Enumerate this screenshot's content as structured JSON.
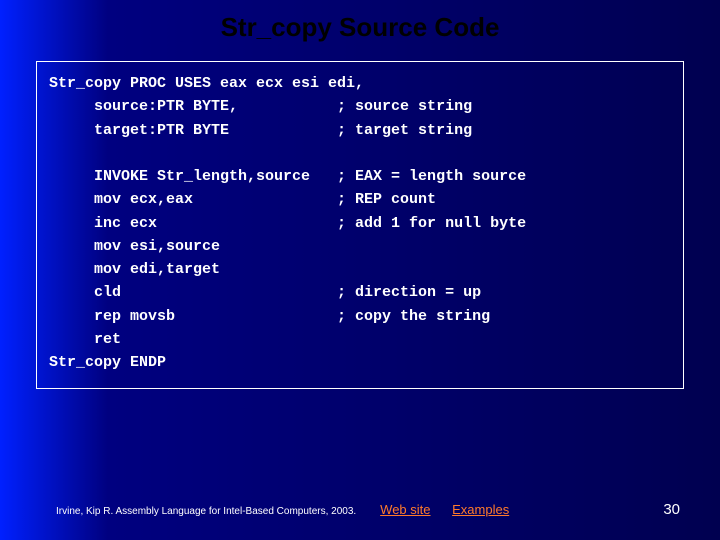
{
  "title": "Str_copy Source Code",
  "code": {
    "l01": "Str_copy PROC USES eax ecx esi edi,",
    "l02": "     source:PTR BYTE,           ; source string",
    "l03": "     target:PTR BYTE            ; target string",
    "l04": "",
    "l05": "     INVOKE Str_length,source   ; EAX = length source",
    "l06": "     mov ecx,eax                ; REP count",
    "l07": "     inc ecx                    ; add 1 for null byte",
    "l08": "     mov esi,source",
    "l09": "     mov edi,target",
    "l10": "     cld                        ; direction = up",
    "l11": "     rep movsb                  ; copy the string",
    "l12": "     ret",
    "l13": "Str_copy ENDP"
  },
  "footer": {
    "citation": "Irvine, Kip R. Assembly Language for Intel-Based Computers, 2003.",
    "link_web": "Web site",
    "link_examples": "Examples",
    "page": "30"
  }
}
